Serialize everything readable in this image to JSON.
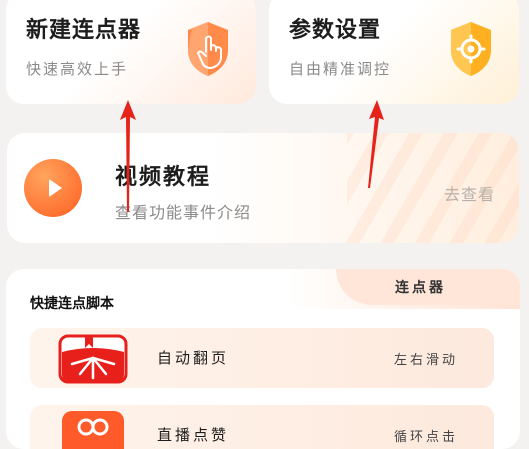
{
  "cards": {
    "new_clicker": {
      "title": "新建连点器",
      "subtitle": "快速高效上手",
      "icon": "hand-tap-icon"
    },
    "settings": {
      "title": "参数设置",
      "subtitle": "自由精准调控",
      "icon": "gear-icon"
    }
  },
  "video": {
    "title": "视频教程",
    "subtitle": "查看功能事件介绍",
    "action": "去查看",
    "icon": "play-icon"
  },
  "panel": {
    "title": "快捷连点脚本",
    "tab": "连点器",
    "items": [
      {
        "label": "自动翻页",
        "right": "左右滑动",
        "icon": "book-page-icon"
      },
      {
        "label": "直播点赞",
        "right": "循环点击",
        "icon": "heart-like-icon"
      }
    ]
  },
  "colors": {
    "accent": "#ff6a2b",
    "card_gradient": "#ffe9dc",
    "arrow": "#e5231a"
  }
}
